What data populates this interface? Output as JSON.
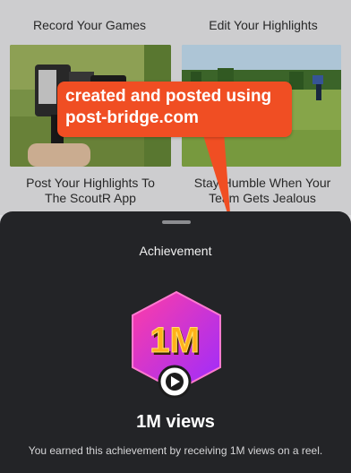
{
  "grid": {
    "cards": [
      {
        "title": "Record Your Games"
      },
      {
        "title": "Edit Your Highlights"
      },
      {
        "title": "Post Your Highlights To The ScoutR App"
      },
      {
        "title": "Stay Humble When Your Team Gets Jealous"
      }
    ]
  },
  "callout": {
    "text": "created and posted using post-bridge.com",
    "color": "#f04e23"
  },
  "sheet": {
    "title": "Achievement",
    "badge_text": "1M",
    "views_label": "1M views",
    "description": "You earned this achievement by receiving 1M views on a reel."
  },
  "colors": {
    "sheet_bg": "#232427",
    "badge_gradient_start": "#ff3da6",
    "badge_gradient_end": "#9b2cff",
    "badge_text": "#ffb21a"
  }
}
